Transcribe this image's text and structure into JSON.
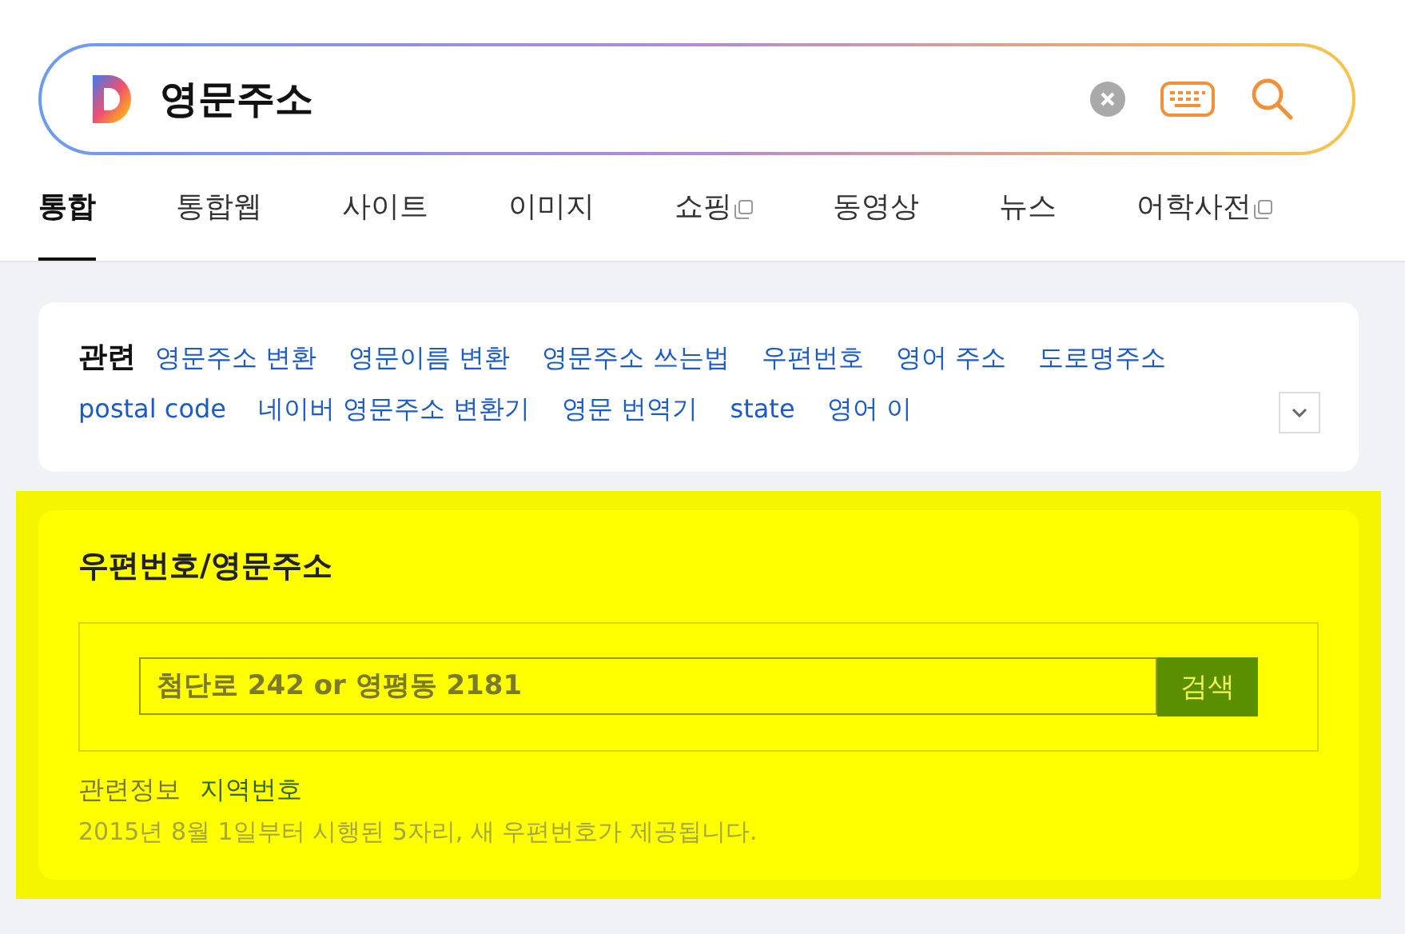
{
  "search": {
    "value": "영문주소"
  },
  "tabs": [
    {
      "label": "통합",
      "selected": true,
      "external": false
    },
    {
      "label": "통합웹",
      "selected": false,
      "external": false
    },
    {
      "label": "사이트",
      "selected": false,
      "external": false
    },
    {
      "label": "이미지",
      "selected": false,
      "external": false
    },
    {
      "label": "쇼핑",
      "selected": false,
      "external": true
    },
    {
      "label": "동영상",
      "selected": false,
      "external": false
    },
    {
      "label": "뉴스",
      "selected": false,
      "external": false
    },
    {
      "label": "어학사전",
      "selected": false,
      "external": true
    }
  ],
  "related": {
    "title": "관련",
    "items": [
      "영문주소 변환",
      "영문이름 변환",
      "영문주소 쓰는법",
      "우편번호",
      "영어 주소",
      "도로명주소",
      "postal code",
      "네이버 영문주소 변환기",
      "영문 번역기",
      "state",
      "영어 이"
    ]
  },
  "postcode": {
    "title": "우편번호/영문주소",
    "placeholder": "첨단로 242 or 영평동 2181",
    "button": "검색",
    "info_label": "관련정보",
    "info_link": "지역번호",
    "note": "2015년 8월 1일부터 시행된 5자리, 새 우편번호가 제공됩니다.",
    "highlighted": true
  }
}
